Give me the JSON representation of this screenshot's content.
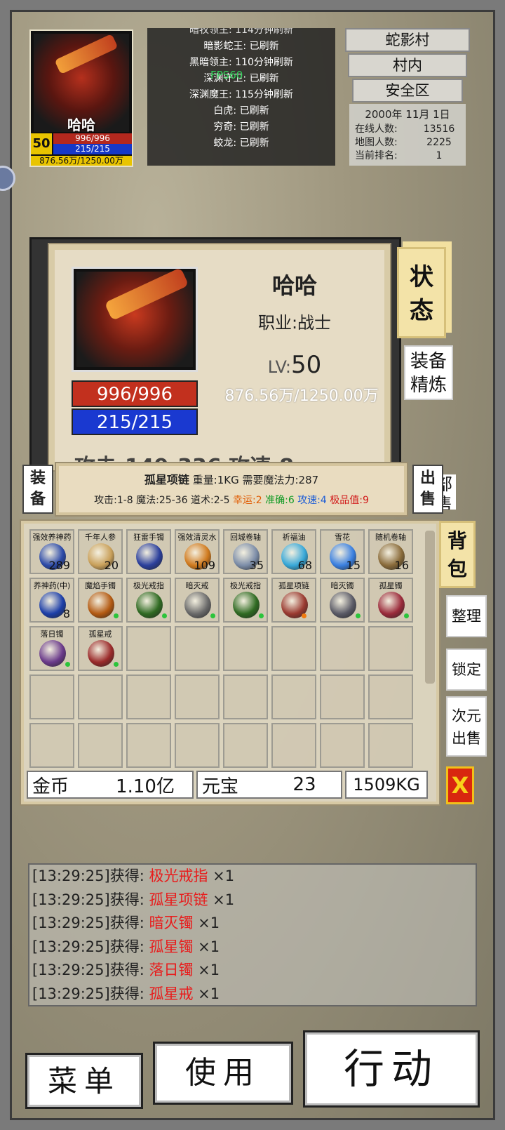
{
  "hud": {
    "name": "哈哈",
    "level": "50",
    "hp": "996/996",
    "mp": "215/215",
    "exp": "876.56万/1250.00万"
  },
  "bosses": [
    "暗牧领主: 114分钟刷新",
    "暗影蛇王: 已刷新",
    "黑暗领主: 110分钟刷新",
    "深渊守卫: 已刷新",
    "深渊魔王: 115分钟刷新",
    "白虎: 已刷新",
    "穷奇: 已刷新",
    "蛟龙: 已刷新"
  ],
  "fps": "FPS60",
  "map": {
    "name": "蛇影村",
    "area": "村内",
    "zone": "安全区",
    "date": "2000年 11月 1日",
    "online_label": "在线人数:",
    "online": "13516",
    "mappeople_label": "地图人数:",
    "mappeople": "2225",
    "rank_label": "当前排名:",
    "rank": "1"
  },
  "character": {
    "name": "哈哈",
    "job": "职业:战士",
    "lv_label": "LV:",
    "lv": "50",
    "exp": "876.56万/1250.00万",
    "hp": "996/996",
    "mp": "215/215",
    "stat_peek": "攻击:149-336  攻速:8"
  },
  "tabs": {
    "status": "状态",
    "refine": "装备精炼",
    "equip": "装备",
    "sell": "出售",
    "partial": "部售",
    "bag": "背包"
  },
  "tooltip": {
    "name": "孤星项链",
    "meta": "重量:1KG 需要魔法力:287",
    "stats": "攻击:1-8 魔法:25-36 道术:2-5",
    "luck": "幸运:2",
    "acc": "准确:6",
    "spd": "攻速:4",
    "extreme": "极品值:9"
  },
  "bag_items": [
    {
      "name": "强效养神药",
      "qty": "289",
      "icon": "potion-bag-icon",
      "color": "#2c4aa8"
    },
    {
      "name": "千年人参",
      "qty": "20",
      "icon": "ginseng-icon",
      "color": "#c9a05a"
    },
    {
      "name": "狂雷手镯",
      "qty": "",
      "icon": "bracelet-icon",
      "color": "#2b3f9c"
    },
    {
      "name": "强效清灵水",
      "qty": "109",
      "icon": "flask-icon",
      "color": "#d07a1e"
    },
    {
      "name": "回城卷轴",
      "qty": "35",
      "icon": "scroll-icon",
      "color": "#7c8da8"
    },
    {
      "name": "祈福油",
      "qty": "68",
      "icon": "oil-bottle-icon",
      "color": "#38a8d8"
    },
    {
      "name": "雪花",
      "qty": "15",
      "icon": "snowflake-icon",
      "color": "#3a7fe0"
    },
    {
      "name": "随机卷轴",
      "qty": "16",
      "icon": "scroll-icon",
      "color": "#8a6b3a"
    },
    {
      "name": "养神药(中)",
      "qty": "8",
      "icon": "potion-icon",
      "color": "#1c3ea8"
    },
    {
      "name": "魔焰手镯",
      "qty": "",
      "icon": "bracelet-icon",
      "color": "#b35a12",
      "dot": "g"
    },
    {
      "name": "极光戒指",
      "qty": "",
      "icon": "ring-icon",
      "color": "#2f6a22",
      "dot": "g"
    },
    {
      "name": "暗灭戒",
      "qty": "",
      "icon": "ring-icon",
      "color": "#6a6a6a",
      "dot": "g"
    },
    {
      "name": "极光戒指",
      "qty": "",
      "icon": "ring-icon",
      "color": "#2f6a22",
      "dot": "g"
    },
    {
      "name": "孤星项链",
      "qty": "",
      "icon": "necklace-icon",
      "color": "#9a3a30",
      "dot": "o"
    },
    {
      "name": "暗灭镯",
      "qty": "",
      "icon": "bracelet-icon",
      "color": "#5a5a66",
      "dot": "g"
    },
    {
      "name": "孤星镯",
      "qty": "",
      "icon": "bracelet-icon",
      "color": "#9a2a3a",
      "dot": "g"
    },
    {
      "name": "落日镯",
      "qty": "",
      "icon": "bracelet-icon",
      "color": "#6a3a8a",
      "dot": "g"
    },
    {
      "name": "孤星戒",
      "qty": "",
      "icon": "ring-icon",
      "color": "#9a2a2a",
      "dot": "g"
    }
  ],
  "bag_slots": 40,
  "wallet": {
    "gold_label": "金币",
    "gold": "1.10亿",
    "ingot_label": "元宝",
    "ingot": "23",
    "weight": "1509KG"
  },
  "side_buttons": {
    "sort": "整理",
    "lock": "锁定",
    "dim_sell": "次元出售",
    "close": "X"
  },
  "log": [
    {
      "time": "[13:29:25]获得: ",
      "item": "极光戒指",
      "count": " ×1"
    },
    {
      "time": "[13:29:25]获得: ",
      "item": "孤星项链",
      "count": " ×1"
    },
    {
      "time": "[13:29:25]获得: ",
      "item": "暗灭镯",
      "count": " ×1"
    },
    {
      "time": "[13:29:25]获得: ",
      "item": "孤星镯",
      "count": " ×1"
    },
    {
      "time": "[13:29:25]获得: ",
      "item": "落日镯",
      "count": " ×1"
    },
    {
      "time": "[13:29:25]获得: ",
      "item": "孤星戒",
      "count": " ×1"
    }
  ],
  "buttons": {
    "menu": "菜单",
    "use": "使用",
    "action": "行动"
  }
}
